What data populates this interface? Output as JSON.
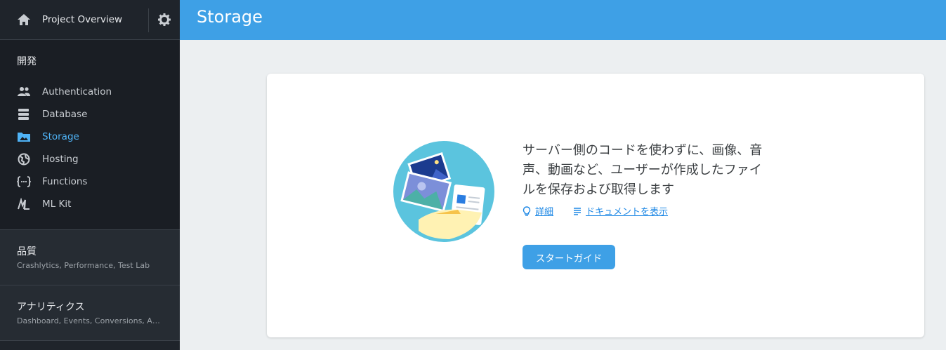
{
  "sidebar": {
    "project_label": "Project Overview",
    "dev_title": "開発",
    "items": [
      {
        "label": "Authentication",
        "icon": "people-icon"
      },
      {
        "label": "Database",
        "icon": "database-icon"
      },
      {
        "label": "Storage",
        "icon": "folder-image-icon",
        "active": true
      },
      {
        "label": "Hosting",
        "icon": "globe-icon"
      },
      {
        "label": "Functions",
        "icon": "functions-icon"
      },
      {
        "label": "ML Kit",
        "icon": "ml-kit-icon"
      }
    ],
    "quality": {
      "title": "品質",
      "subtitle": "Crashlytics, Performance, Test Lab"
    },
    "analytics": {
      "title": "アナリティクス",
      "subtitle": "Dashboard, Events, Conversions, Audiences"
    }
  },
  "header": {
    "title": "Storage"
  },
  "card": {
    "line1": "サーバー側のコードを使わずに、画像、音",
    "line2": "声、動画など、ユーザーが作成したファイ",
    "line3": "ルを保存および取得します",
    "link_details": "詳細",
    "link_docs": "ドキュメントを表示",
    "button": "スタートガイド"
  },
  "colors": {
    "accent": "#3ea0e6",
    "active": "#4fb3f6",
    "sidebar": "#1f242b"
  }
}
